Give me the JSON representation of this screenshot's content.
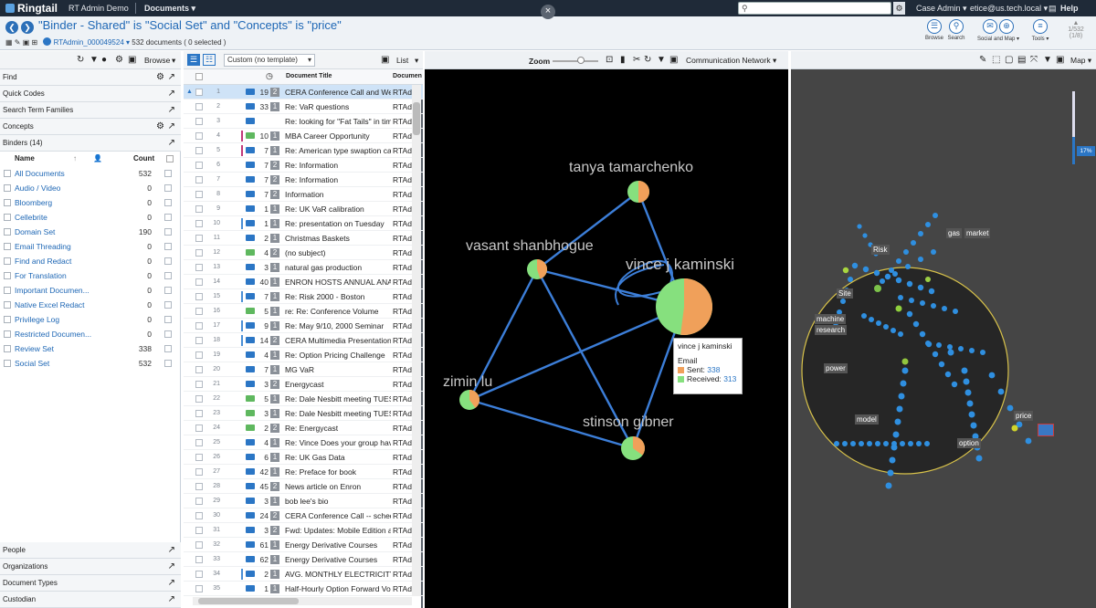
{
  "app": {
    "brand": "Ringtail",
    "case_name": "RT Admin Demo",
    "section_menu": "Documents ▾",
    "search_placeholder": "",
    "role_menu": "Case Admin ▾",
    "user_menu": "etice@us.tech.local ▾",
    "help": "Help",
    "close_symbol": "×"
  },
  "query": {
    "text": "\"Binder - Shared\" is \"Social Set\" and \"Concepts\" is \"price\"",
    "result_set": "RTAdmin_000049524 ▾",
    "doc_count": "532 documents",
    "selected": "( 0 selected )"
  },
  "toolbar": {
    "browse": "Browse",
    "search": "Search",
    "social_map": "Social and Map ▾",
    "tools": "Tools ▾",
    "pager_top": "1/532",
    "pager_bottom": "(1/8)"
  },
  "left_panel": {
    "mode": "Browse",
    "sections_top": [
      "Find",
      "Quick Codes",
      "Search Term Families",
      "Concepts"
    ],
    "binders_title": "Binders (14)",
    "col_name": "Name",
    "col_count": "Count",
    "binders": [
      {
        "name": "All Documents",
        "count": "532"
      },
      {
        "name": "Audio / Video",
        "count": "0"
      },
      {
        "name": "Bloomberg",
        "count": "0"
      },
      {
        "name": "Cellebrite",
        "count": "0"
      },
      {
        "name": "Domain Set",
        "count": "190"
      },
      {
        "name": "Email Threading",
        "count": "0"
      },
      {
        "name": "Find and Redact",
        "count": "0"
      },
      {
        "name": "For Translation",
        "count": "0"
      },
      {
        "name": "Important Documen...",
        "count": "0"
      },
      {
        "name": "Native Excel Redact",
        "count": "0"
      },
      {
        "name": "Privilege Log",
        "count": "0"
      },
      {
        "name": "Restricted Documen...",
        "count": "0"
      },
      {
        "name": "Review Set",
        "count": "338"
      },
      {
        "name": "Social Set",
        "count": "532"
      }
    ],
    "sections_bottom": [
      "People",
      "Organizations",
      "Document Types",
      "Custodian"
    ]
  },
  "doc_list": {
    "template": "Custom (no template)",
    "view_mode": "List",
    "col_title": "Document Title",
    "col_from": "Documen",
    "rows": [
      {
        "n": "1",
        "c": "19",
        "b": "2",
        "t": "CERA Conference Call and Web",
        "f": "RTAd",
        "g": false,
        "bar": ""
      },
      {
        "n": "2",
        "c": "33",
        "b": "1",
        "t": "Re: VaR questions",
        "f": "RTAd",
        "g": false,
        "bar": ""
      },
      {
        "n": "3",
        "c": "",
        "b": "",
        "t": "Re: looking for \"Fat Tails\" in tim",
        "f": "RTAd",
        "g": false,
        "bar": ""
      },
      {
        "n": "4",
        "c": "10",
        "b": "1",
        "t": "MBA Career Opportunity",
        "f": "RTAd",
        "g": true,
        "bar": "#c23a7a"
      },
      {
        "n": "5",
        "c": "7",
        "b": "1",
        "t": "Re: American type swaption cal",
        "f": "RTAd",
        "g": false,
        "bar": "#c23a7a"
      },
      {
        "n": "6",
        "c": "7",
        "b": "2",
        "t": "Re: Information",
        "f": "RTAd",
        "g": false,
        "bar": ""
      },
      {
        "n": "7",
        "c": "7",
        "b": "2",
        "t": "Re: Information",
        "f": "RTAd",
        "g": false,
        "bar": ""
      },
      {
        "n": "8",
        "c": "7",
        "b": "2",
        "t": "Information",
        "f": "RTAd",
        "g": false,
        "bar": ""
      },
      {
        "n": "9",
        "c": "1",
        "b": "1",
        "t": "Re: UK VaR calibration",
        "f": "RTAd",
        "g": false,
        "bar": ""
      },
      {
        "n": "10",
        "c": "1",
        "b": "1",
        "t": "Re: presentation on Tuesday",
        "f": "RTAd",
        "g": false,
        "bar": "#4a8fd6"
      },
      {
        "n": "11",
        "c": "2",
        "b": "1",
        "t": "Christmas Baskets",
        "f": "RTAd",
        "g": false,
        "bar": ""
      },
      {
        "n": "12",
        "c": "4",
        "b": "2",
        "t": "(no subject)",
        "f": "RTAd",
        "g": true,
        "bar": ""
      },
      {
        "n": "13",
        "c": "3",
        "b": "1",
        "t": "natural gas production",
        "f": "RTAd",
        "g": false,
        "bar": ""
      },
      {
        "n": "14",
        "c": "40",
        "b": "1",
        "t": "ENRON HOSTS ANNUAL ANALY",
        "f": "RTAd",
        "g": false,
        "bar": ""
      },
      {
        "n": "15",
        "c": "7",
        "b": "1",
        "t": "Re: Risk 2000 - Boston",
        "f": "RTAd",
        "g": false,
        "bar": "#4a8fd6"
      },
      {
        "n": "16",
        "c": "5",
        "b": "1",
        "t": "re: Re: Conference Volume",
        "f": "RTAd",
        "g": true,
        "bar": ""
      },
      {
        "n": "17",
        "c": "9",
        "b": "1",
        "t": "Re: May 9/10, 2000 Seminar",
        "f": "RTAd",
        "g": false,
        "bar": "#4a8fd6"
      },
      {
        "n": "18",
        "c": "14",
        "b": "2",
        "t": "CERA Multimedia Presentation:",
        "f": "RTAd",
        "g": false,
        "bar": "#4a8fd6"
      },
      {
        "n": "19",
        "c": "4",
        "b": "1",
        "t": "Re: Option Pricing Challenge",
        "f": "RTAd",
        "g": false,
        "bar": ""
      },
      {
        "n": "20",
        "c": "7",
        "b": "1",
        "t": "MG VaR",
        "f": "RTAd",
        "g": false,
        "bar": ""
      },
      {
        "n": "21",
        "c": "3",
        "b": "2",
        "t": "Energycast",
        "f": "RTAd",
        "g": false,
        "bar": ""
      },
      {
        "n": "22",
        "c": "5",
        "b": "1",
        "t": "Re: Dale Nesbitt meeting TUES",
        "f": "RTAd",
        "g": true,
        "bar": ""
      },
      {
        "n": "23",
        "c": "3",
        "b": "1",
        "t": "Re: Dale Nesbitt meeting TUES",
        "f": "RTAd",
        "g": true,
        "bar": ""
      },
      {
        "n": "24",
        "c": "2",
        "b": "2",
        "t": "Re: Energycast",
        "f": "RTAd",
        "g": true,
        "bar": ""
      },
      {
        "n": "25",
        "c": "4",
        "b": "1",
        "t": "Re: Vince Does your group have",
        "f": "RTAd",
        "g": false,
        "bar": ""
      },
      {
        "n": "26",
        "c": "6",
        "b": "1",
        "t": "Re: UK Gas Data",
        "f": "RTAd",
        "g": false,
        "bar": ""
      },
      {
        "n": "27",
        "c": "42",
        "b": "1",
        "t": "Re: Preface for book",
        "f": "RTAd",
        "g": false,
        "bar": ""
      },
      {
        "n": "28",
        "c": "45",
        "b": "2",
        "t": "News article on Enron",
        "f": "RTAd",
        "g": false,
        "bar": ""
      },
      {
        "n": "29",
        "c": "3",
        "b": "1",
        "t": "bob lee's bio",
        "f": "RTAd",
        "g": false,
        "bar": ""
      },
      {
        "n": "30",
        "c": "24",
        "b": "2",
        "t": "CERA Conference Call -- schedu",
        "f": "RTAd",
        "g": false,
        "bar": ""
      },
      {
        "n": "31",
        "c": "3",
        "b": "2",
        "t": "Fwd: Updates: Mobile Edition ar",
        "f": "RTAd",
        "g": false,
        "bar": ""
      },
      {
        "n": "32",
        "c": "61",
        "b": "1",
        "t": "Energy Derivative Courses",
        "f": "RTAd",
        "g": false,
        "bar": ""
      },
      {
        "n": "33",
        "c": "62",
        "b": "1",
        "t": "Energy Derivative Courses",
        "f": "RTAd",
        "g": false,
        "bar": ""
      },
      {
        "n": "34",
        "c": "2",
        "b": "1",
        "t": "AVG. MONTHLY ELECTRICITY PI",
        "f": "RTAd",
        "g": false,
        "bar": "#4a8fd6"
      },
      {
        "n": "35",
        "c": "1",
        "b": "1",
        "t": "Half-Hourly Option Forward Vo",
        "f": "RTAd",
        "g": false,
        "bar": ""
      }
    ]
  },
  "network": {
    "zoom_label": "Zoom",
    "view_menu": "Communication Network ▾",
    "nodes": [
      {
        "id": "tanya",
        "label": "tanya tamarchenko",
        "sent_frac": 0.5
      },
      {
        "id": "vasant",
        "label": "vasant shanbhogue",
        "sent_frac": 0.45
      },
      {
        "id": "vince",
        "label": "vince j kaminski",
        "sent_frac": 0.52
      },
      {
        "id": "zimin",
        "label": "zimin lu",
        "sent_frac": 0.4
      },
      {
        "id": "stinson",
        "label": "stinson gibner",
        "sent_frac": 0.35
      }
    ],
    "tooltip": {
      "name": "vince j kaminski",
      "type": "Email",
      "sent_label": "Sent:",
      "sent": "338",
      "recv_label": "Received:",
      "received": "313"
    },
    "colors": {
      "sent": "#f0a05a",
      "received": "#86e07e",
      "edge": "#3c7ed8"
    }
  },
  "map": {
    "view_menu": "Map ▾",
    "zoom_pct": "17%",
    "labels": [
      "gas",
      "market",
      "Risk",
      "Site",
      "machine",
      "research",
      "power",
      "model",
      "option",
      "price"
    ]
  }
}
